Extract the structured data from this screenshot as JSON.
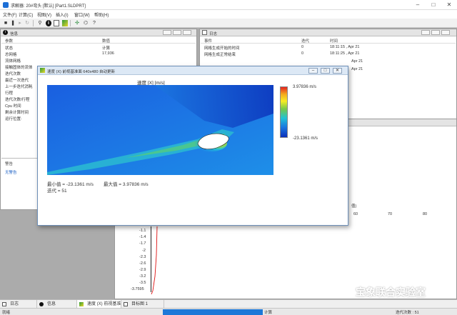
{
  "window": {
    "title": "求解器: 20#弯头 [默认] [Part1.SLDPRT]"
  },
  "menu": [
    "文件(F)",
    "计算(C)",
    "视图(V)",
    "插入(I)",
    "窗口(W)",
    "帮助(H)"
  ],
  "toolbar": {
    "icons": [
      "stop-icon",
      "pause-icon",
      "step-icon",
      "refresh-icon",
      "pin-icon",
      "info-icon",
      "chart-icon",
      "preview-icon",
      "trace-icon",
      "filter-icon"
    ]
  },
  "info_panel": {
    "title": "信息",
    "columns": [
      "参数",
      "数值"
    ],
    "rows": [
      {
        "param": "状态",
        "value": "计算"
      },
      {
        "param": "总网格",
        "value": "17,936"
      },
      {
        "param": "流体网格",
        "value": ""
      },
      {
        "param": "接触固体的流体",
        "value": ""
      },
      {
        "param": "迭代次数",
        "value": ""
      },
      {
        "param": "最近一次迭代",
        "value": ""
      },
      {
        "param": "上一步迭代消耗",
        "value": ""
      },
      {
        "param": "行程",
        "value": ""
      },
      {
        "param": "迭代次数/行程",
        "value": ""
      },
      {
        "param": "Cpu 时间",
        "value": ""
      },
      {
        "param": "剩余计算时间",
        "value": ""
      },
      {
        "param": "运行位置:",
        "value": ""
      }
    ],
    "warning_header": "警告",
    "warning_text": "无警告"
  },
  "log_panel": {
    "title": "日志",
    "columns": [
      "事件",
      "迭代",
      "时间"
    ],
    "rows": [
      {
        "event": "网格生成开始的时间",
        "iter": "0",
        "time": "18:11:15 , Apr 21"
      },
      {
        "event": "网格生成正常结束",
        "iter": "0",
        "time": "18:11:25 , Apr 21"
      },
      {
        "event": "",
        "iter": "",
        "time": "Apr 21"
      },
      {
        "event": "",
        "iter": "",
        "time": "Apr 21"
      }
    ]
  },
  "graph_panel": {
    "xaxis_label_fragment": "值)",
    "x_ticks": [
      "60",
      "70",
      "80"
    ],
    "y_ticks": [
      "-1.1",
      "-1.4",
      "-1.7",
      "-2",
      "-2.3",
      "-2.6",
      "-2.9",
      "-3.2",
      "-3.5",
      "-3.7595"
    ]
  },
  "preview_dialog": {
    "title": "速度 (X) 前视基准面 640x480 自动更新",
    "plot_title": "速度 [X] [m/s]",
    "colorbar_max_label": "3.97836 m/s",
    "colorbar_min_label": "-23.1361 m/s",
    "min_label": "最小值 = -23.1361 m/s",
    "max_label": "最大值 = 3.97836 m/s",
    "iteration_label": "迭代 = 51",
    "min_value": -23.1361,
    "max_value": 3.97836,
    "iteration": 51,
    "colors": [
      "#e52220",
      "#f4a81c",
      "#f7ec23",
      "#74c84a",
      "#22c2d5",
      "#1b78e0",
      "#0b2fb9"
    ]
  },
  "tabs": [
    "日志",
    "信息",
    "速度 (X) 前视基准",
    "目标图 1"
  ],
  "status": {
    "left": "就绪",
    "center": "计算",
    "right": "迭代次数 : 51"
  },
  "watermark": "宝象联合实验室"
}
